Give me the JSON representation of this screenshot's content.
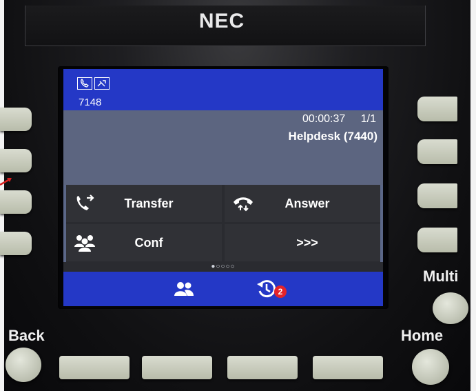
{
  "brand": "NEC",
  "screen": {
    "extension": "7148",
    "call_timer": "00:00:37",
    "call_count": "1/1",
    "caller": "Helpdesk (7440)"
  },
  "softkeys": [
    {
      "label": "Transfer",
      "icon": "transfer-icon"
    },
    {
      "label": "Answer",
      "icon": "answer-icon"
    },
    {
      "label": "Conf",
      "icon": "conference-icon"
    },
    {
      "label": ">>>",
      "icon": ""
    }
  ],
  "page_indicator": "●○○○○",
  "bottom_bar": {
    "history_badge": "2"
  },
  "hardware_labels": {
    "multi": "Multi",
    "back": "Back",
    "home": "Home"
  },
  "colors": {
    "status_bar": "#2438c6",
    "badge": "#e3232b"
  }
}
